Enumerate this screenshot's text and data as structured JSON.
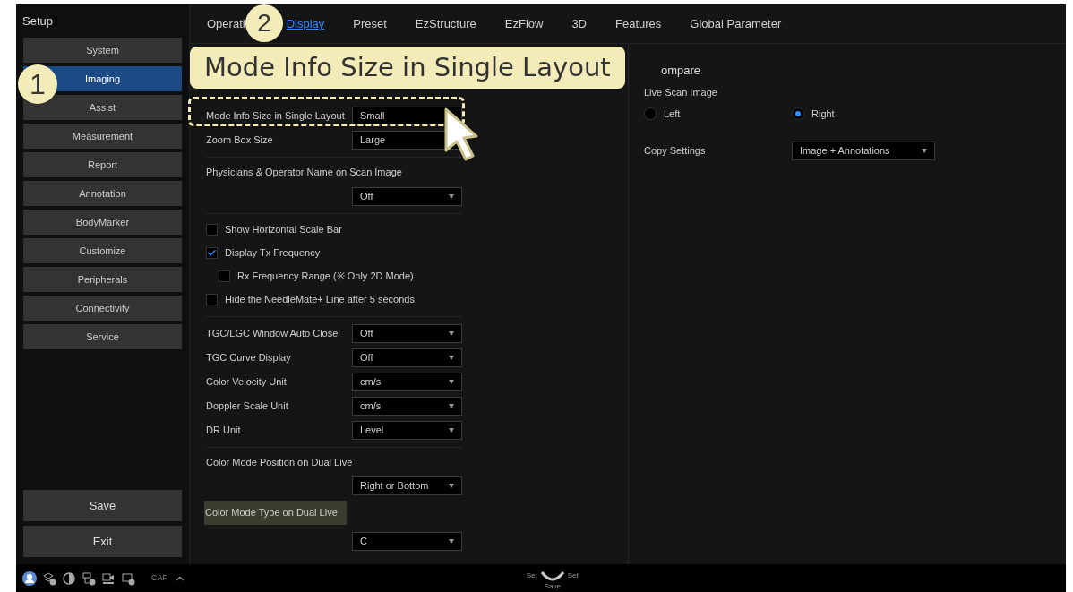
{
  "sidebar": {
    "title": "Setup",
    "items": [
      {
        "label": "System",
        "selected": false
      },
      {
        "label": "Imaging",
        "selected": true
      },
      {
        "label": "Assist",
        "selected": false
      },
      {
        "label": "Measurement",
        "selected": false
      },
      {
        "label": "Report",
        "selected": false
      },
      {
        "label": "Annotation",
        "selected": false
      },
      {
        "label": "BodyMarker",
        "selected": false
      },
      {
        "label": "Customize",
        "selected": false
      },
      {
        "label": "Peripherals",
        "selected": false
      },
      {
        "label": "Connectivity",
        "selected": false
      },
      {
        "label": "Service",
        "selected": false
      }
    ],
    "buttons": [
      "Save",
      "Exit"
    ]
  },
  "tabs": [
    {
      "label": "Operati",
      "selected": false
    },
    {
      "label": "Display",
      "selected": true
    },
    {
      "label": "Preset",
      "selected": false
    },
    {
      "label": "EzStructure",
      "selected": false
    },
    {
      "label": "EzFlow",
      "selected": false
    },
    {
      "label": "3D",
      "selected": false
    },
    {
      "label": "Features",
      "selected": false
    },
    {
      "label": "Global Parameter",
      "selected": false
    }
  ],
  "left_groups": [
    [
      {
        "kind": "select",
        "label": "Mode Info Size in Single Layout",
        "value": "Small",
        "highlighted": false
      },
      {
        "kind": "select",
        "label": "Zoom Box Size",
        "value": "Large",
        "highlighted": false
      }
    ],
    [
      {
        "kind": "select_below",
        "label": "Physicians & Operator Name on Scan Image",
        "value": "Off",
        "highlighted": false
      }
    ],
    [
      {
        "kind": "checkbox",
        "label": "Show Horizontal Scale Bar",
        "checked": false
      },
      {
        "kind": "checkbox",
        "label": "Display Tx Frequency",
        "checked": true,
        "children": [
          {
            "kind": "checkbox",
            "label": "Rx Frequency Range (※ Only 2D Mode)",
            "checked": false
          }
        ]
      },
      {
        "kind": "checkbox",
        "label": "Hide the NeedleMate+ Line after 5 seconds",
        "checked": false
      }
    ],
    [
      {
        "kind": "select",
        "label": "TGC/LGC Window Auto Close",
        "value": "Off",
        "highlighted": false
      },
      {
        "kind": "select",
        "label": "TGC Curve Display",
        "value": "Off",
        "highlighted": false
      },
      {
        "kind": "select",
        "label": "Color Velocity Unit",
        "value": "cm/s",
        "highlighted": false
      },
      {
        "kind": "select",
        "label": "Doppler Scale Unit",
        "value": "cm/s",
        "highlighted": false
      },
      {
        "kind": "select",
        "label": "DR Unit",
        "value": "Level",
        "highlighted": false
      }
    ],
    [
      {
        "kind": "select_below",
        "label": "Color Mode Position on Dual Live",
        "value": "Right or Bottom",
        "highlighted": false
      },
      {
        "kind": "select_below",
        "label": "Color Mode Type on Dual Live",
        "value": "C",
        "highlighted": true
      }
    ]
  ],
  "compare": {
    "title": "ompare",
    "subtitle": "Live Scan Image",
    "radios": [
      {
        "label": "Left",
        "selected": false
      },
      {
        "label": "Right",
        "selected": true
      }
    ],
    "copy_label": "Copy Settings",
    "copy_value": "Image + Annotations"
  },
  "status_bar": {
    "cap": "CAP",
    "dial_left": "Set",
    "dial_right": "Set",
    "dial_bottom": "Save"
  },
  "callout": {
    "badges": [
      "1",
      "2"
    ],
    "text": "Mode Info Size in Single Layout"
  }
}
